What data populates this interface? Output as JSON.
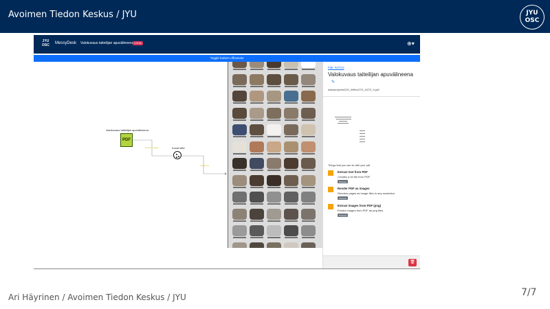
{
  "slide": {
    "title": "Avoimen Tiedon Keskus / JYU",
    "logo_line1": "JYU",
    "logo_line2": "OSC",
    "footer": "Ari Häyrinen / Avoimen Tiedon Keskus / JYU",
    "page_number": "7/7"
  },
  "app": {
    "logo_line1": "JYU",
    "logo_line2": "OSC",
    "brand": "MessyDesk",
    "project": "Valokuvaus taiteilijan apuvälineena",
    "badge": "LOCAL",
    "settings_icon": "⊕▾",
    "toggle_label": "Toggle bottom offcanvas"
  },
  "flow": {
    "source_label": "Valokuvaus taiteilijan apuvälineena",
    "source_icon": "PDF",
    "node_label": "Kuvat sitte",
    "edge1_label": "Extract images",
    "edge2_label": "image set"
  },
  "colors": {
    "thumbs": [
      "#6b5848",
      "#9b8b78",
      "#4a3a2e",
      "#c8c0b0",
      "#ffffff",
      "#7a6a5a",
      "#8d7a62",
      "#5e4e40",
      "#6a5a4a",
      "#93867a",
      "#54463a",
      "#b09780",
      "#a79681",
      "#486f8f",
      "#8a6a4e",
      "#5a4a3c",
      "#a99a8a",
      "#7e6e5e",
      "#8a7a6a",
      "#6e5e50",
      "#3e4e72",
      "#5f4f40",
      "#f4f2ee",
      "#7a6a5c",
      "#cfc3b0",
      "#e6e1d8",
      "#b07a5a",
      "#c8a888",
      "#a89070",
      "#c09070",
      "#3a302a",
      "#404a60",
      "#8a7a6c",
      "#4c3c30",
      "#6a5a4c",
      "#9c8c7c",
      "#4a3c30",
      "#3a2e26",
      "#6e5e50",
      "#a4947e",
      "#707070",
      "#505050",
      "#909090",
      "#606060",
      "#808080",
      "#8c8276",
      "#4c443c",
      "#a09a92",
      "#5c544c",
      "#7c746c",
      "#9a9a9a",
      "#5a5a5a",
      "#bcbcbc",
      "#4c4c4c",
      "#8c8c8c",
      "#a0968a",
      "#504840",
      "#7a7060",
      "#d0c8c0",
      "#6a6258",
      "#5a5046",
      "#3c3630",
      "#7c7468",
      "#4e463e",
      "#6e6458"
    ]
  },
  "details": {
    "file_link": "File: #270:0",
    "file_title": "Valokuvaus taiteilijan apuvälineena",
    "file_path": "data/projects/220_0/files/270_9/270_9.pdf",
    "things_heading": "Things that you can do with your pdf",
    "actions": [
      {
        "title": "Extract text from PDF",
        "desc": "Creates a txt file from PDF.",
        "button": "Process"
      },
      {
        "title": "Render PDF as images",
        "desc": "Renders pages as image files in any resolution.",
        "button": "Process"
      },
      {
        "title": "Extract images from PDF (png)",
        "desc": "Extract images from PDF as png files.",
        "button": "Process"
      }
    ],
    "trash_icon": "🗑"
  }
}
